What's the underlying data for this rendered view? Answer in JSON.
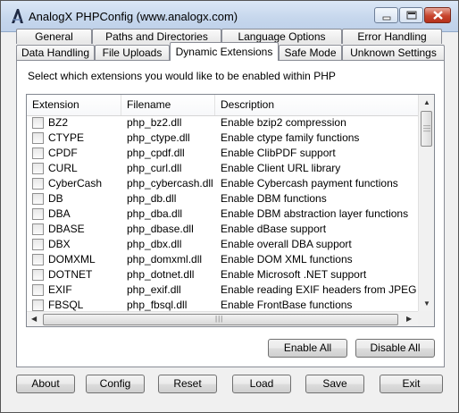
{
  "window": {
    "title": "AnalogX PHPConfig (www.analogx.com)"
  },
  "tabs_row_back": [
    {
      "label": "General"
    },
    {
      "label": "Paths and Directories"
    },
    {
      "label": "Language Options"
    },
    {
      "label": "Error Handling"
    }
  ],
  "tabs_row_front": [
    {
      "label": "Data Handling"
    },
    {
      "label": "File Uploads"
    },
    {
      "label": "Dynamic Extensions"
    },
    {
      "label": "Safe Mode"
    },
    {
      "label": "Unknown Settings"
    }
  ],
  "active_tab": "Dynamic Extensions",
  "panel": {
    "instruction": "Select which extensions you would like to be enabled within PHP",
    "columns": [
      "Extension",
      "Filename",
      "Description"
    ],
    "extensions": [
      {
        "ext": "BZ2",
        "file": "php_bz2.dll",
        "desc": "Enable bzip2 compression",
        "checked": false
      },
      {
        "ext": "CTYPE",
        "file": "php_ctype.dll",
        "desc": "Enable ctype family functions",
        "checked": false
      },
      {
        "ext": "CPDF",
        "file": "php_cpdf.dll",
        "desc": "Enable ClibPDF support",
        "checked": false
      },
      {
        "ext": "CURL",
        "file": "php_curl.dll",
        "desc": "Enable Client URL library",
        "checked": false
      },
      {
        "ext": "CyberCash",
        "file": "php_cybercash.dll",
        "desc": "Enable Cybercash payment functions",
        "checked": false
      },
      {
        "ext": "DB",
        "file": "php_db.dll",
        "desc": "Enable DBM functions",
        "checked": false
      },
      {
        "ext": "DBA",
        "file": "php_dba.dll",
        "desc": "Enable DBM abstraction layer functions",
        "checked": false
      },
      {
        "ext": "DBASE",
        "file": "php_dbase.dll",
        "desc": "Enable dBase support",
        "checked": false
      },
      {
        "ext": "DBX",
        "file": "php_dbx.dll",
        "desc": "Enable overall DBA support",
        "checked": false
      },
      {
        "ext": "DOMXML",
        "file": "php_domxml.dll",
        "desc": "Enable DOM XML functions",
        "checked": false
      },
      {
        "ext": "DOTNET",
        "file": "php_dotnet.dll",
        "desc": "Enable Microsoft .NET support",
        "checked": false
      },
      {
        "ext": "EXIF",
        "file": "php_exif.dll",
        "desc": "Enable reading EXIF headers from JPEG",
        "checked": false
      },
      {
        "ext": "FBSQL",
        "file": "php_fbsql.dll",
        "desc": "Enable FrontBase functions",
        "checked": false
      }
    ],
    "enable_all_label": "Enable All",
    "disable_all_label": "Disable All"
  },
  "footer": {
    "about_label": "About",
    "config_label": "Config",
    "reset_label": "Reset",
    "load_label": "Load",
    "save_label": "Save",
    "exit_label": "Exit"
  },
  "icons": {
    "app": "analogx-app-icon",
    "minimize": "minimize-icon",
    "maximize": "maximize-icon",
    "close": "close-icon"
  }
}
